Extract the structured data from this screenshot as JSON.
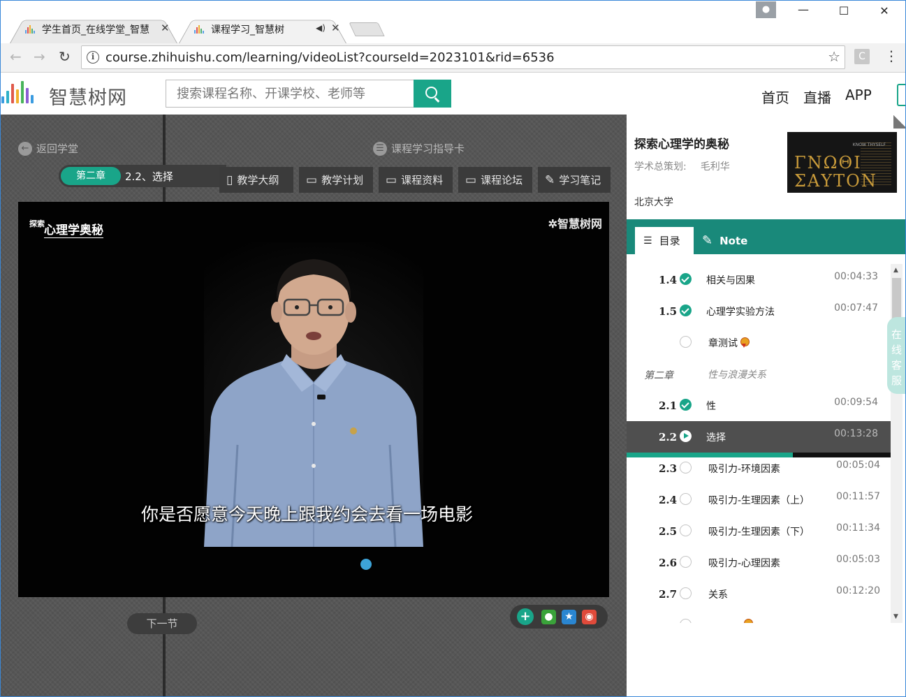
{
  "browser": {
    "tabs": [
      {
        "title": "学生首页_在线学堂_智慧",
        "active": false
      },
      {
        "title": "课程学习_智慧树",
        "active": true
      }
    ],
    "url": "course.zhihuishu.com/learning/videoList?courseId=2023101&rid=6536",
    "info_glyph": "i",
    "extension_label": "C"
  },
  "site": {
    "logo_text": "智慧树网",
    "search_placeholder": "搜索课程名称、开课学校、老师等",
    "nav": [
      "首页",
      "直播",
      "APP"
    ]
  },
  "player": {
    "back_label": "返回学堂",
    "guide_label": "课程学习指导卡",
    "chapter_pill": "第二章",
    "chapter_title": "2.2、选择",
    "tools": [
      "教学大纲",
      "教学计划",
      "课程资料",
      "课程论坛",
      "学习笔记"
    ],
    "video_logo_small": "探索",
    "video_logo_big": "心理学奥秘",
    "watermark": "智慧树网",
    "subtitle": "你是否愿意今天晚上跟我约会去看一场电影",
    "next_label": "下一节"
  },
  "course": {
    "name": "探索心理学的奥秘",
    "planner_label": "学术总策划:",
    "planner": "毛利华",
    "school": "北京大学",
    "cover_line1": "ΓΝΩΘΙ",
    "cover_line2": "ΣΑΥΤΟΝ",
    "cover_small": "KNOW THYSELF"
  },
  "panel_tabs": {
    "toc": "目录",
    "note": "Note"
  },
  "toc": {
    "items": [
      {
        "num": "1.4",
        "title": "相关与因果",
        "time": "00:04:33",
        "status": "done"
      },
      {
        "num": "1.5",
        "title": "心理学实验方法",
        "time": "00:07:47",
        "status": "done"
      },
      {
        "num": "",
        "title": "章测试",
        "time": "",
        "status": "quiz"
      },
      {
        "num": "第二章",
        "title": "性与浪漫关系",
        "time": "",
        "status": "chapter"
      },
      {
        "num": "2.1",
        "title": "性",
        "time": "00:09:54",
        "status": "done"
      },
      {
        "num": "2.2",
        "title": "选择",
        "time": "00:13:28",
        "status": "current"
      },
      {
        "num": "2.3",
        "title": "吸引力-环境因素",
        "time": "00:05:04",
        "status": "todo"
      },
      {
        "num": "2.4",
        "title": "吸引力-生理因素（上）",
        "time": "00:11:57",
        "status": "todo"
      },
      {
        "num": "2.5",
        "title": "吸引力-生理因素（下）",
        "time": "00:11:34",
        "status": "todo"
      },
      {
        "num": "2.6",
        "title": "吸引力-心理因素",
        "time": "00:05:03",
        "status": "todo"
      },
      {
        "num": "2.7",
        "title": "关系",
        "time": "00:12:20",
        "status": "todo"
      }
    ],
    "current_progress": 0.63
  },
  "service_label": "在线客服",
  "colors": {
    "brand": "#19a589",
    "tab_bar": "#19897a",
    "stage": "#565656"
  }
}
